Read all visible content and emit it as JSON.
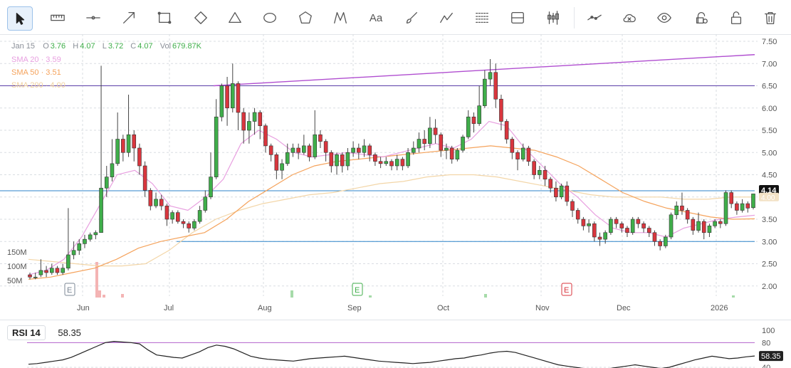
{
  "toolbar": {
    "tools": [
      {
        "name": "cursor-tool",
        "icon": "cursor-icon",
        "active": true
      },
      {
        "name": "measure-tool",
        "icon": "ruler-icon"
      },
      {
        "name": "horizontal-line-tool",
        "icon": "horizontal-line-icon"
      },
      {
        "name": "trend-line-tool",
        "icon": "arrow-line-icon"
      },
      {
        "name": "rectangle-tool",
        "icon": "rectangle-icon"
      },
      {
        "name": "rotated-rectangle-tool",
        "icon": "diamond-icon"
      },
      {
        "name": "triangle-tool",
        "icon": "triangle-icon"
      },
      {
        "name": "ellipse-tool",
        "icon": "ellipse-icon"
      },
      {
        "name": "polygon-tool",
        "icon": "polygon-icon"
      },
      {
        "name": "xabcd-pattern-tool",
        "icon": "pattern-icon"
      },
      {
        "name": "text-tool",
        "icon": "text-icon",
        "label": "Aa"
      },
      {
        "name": "brush-tool",
        "icon": "brush-icon"
      },
      {
        "name": "path-tool",
        "icon": "path-icon"
      },
      {
        "name": "fib-retracement-tool",
        "icon": "fib-icon"
      },
      {
        "name": "long-short-position-tool",
        "icon": "position-icon"
      },
      {
        "name": "magnet-tool",
        "icon": "candles-icon"
      },
      {
        "name": "show-drawings-tool",
        "icon": "line-visibility-icon"
      },
      {
        "name": "delete-drawings-x-tool",
        "icon": "cloud-x-icon"
      },
      {
        "name": "hide-drawings-tool",
        "icon": "eye-icon"
      },
      {
        "name": "lock-drawings-tool",
        "icon": "lock-settings-icon"
      },
      {
        "name": "unlock-tool",
        "icon": "unlock-icon"
      },
      {
        "name": "delete-tool",
        "icon": "trash-icon"
      }
    ]
  },
  "legend": {
    "date": "Jan 15",
    "open_key": "O",
    "open": "3.76",
    "high_key": "H",
    "high": "4.07",
    "low_key": "L",
    "low": "3.72",
    "close_key": "C",
    "close": "4.07",
    "vol_key": "Vol",
    "volume": "679.87K",
    "sma20": "SMA 20 · 3.59",
    "sma50": "SMA 50 · 3.51",
    "sma200": "SMA 200 · 4.00"
  },
  "colors": {
    "up": "#3fae4a",
    "down": "#d9363e",
    "sma20": "#e8a0e0",
    "sma50": "#f5a35c",
    "sma200": "#f3d6a8",
    "hline": "#2c83c9",
    "trendline": "#b04ed0",
    "resistance": "#5b3fa8",
    "rsi": "#222222",
    "rsi_fill": "#c58ee6",
    "price_tag": "#111111"
  },
  "chart_data": {
    "type": "candlestick",
    "y_axis": {
      "ticks": [
        "7.50",
        "7.00",
        "6.50",
        "6.00",
        "5.50",
        "5.00",
        "4.50",
        "4.00",
        "3.50",
        "3.00",
        "2.50",
        "2.00"
      ],
      "ylim": [
        1.9,
        7.5
      ],
      "position": "right"
    },
    "volume_axis": {
      "ticks": [
        "150M",
        "100M",
        "50M"
      ]
    },
    "x_axis": {
      "labels": [
        "Jun",
        "Jul",
        "Aug",
        "Sep",
        "Oct",
        "Nov",
        "Dec",
        "2026"
      ]
    },
    "events": [
      "E",
      "E",
      "E"
    ],
    "candles": [
      [
        2.25,
        2.2,
        2.3,
        2.15
      ],
      [
        2.2,
        2.2,
        2.3,
        2.15
      ],
      [
        2.25,
        2.35,
        2.6,
        2.2
      ],
      [
        2.35,
        2.3,
        2.45,
        2.2
      ],
      [
        2.3,
        2.4,
        2.5,
        2.25
      ],
      [
        2.4,
        2.3,
        2.45,
        2.25
      ],
      [
        2.3,
        2.4,
        2.5,
        2.25
      ],
      [
        2.4,
        2.7,
        3.75,
        2.35
      ],
      [
        2.7,
        2.8,
        3.0,
        2.6
      ],
      [
        2.8,
        2.95,
        3.05,
        2.7
      ],
      [
        2.95,
        3.05,
        3.15,
        2.85
      ],
      [
        3.05,
        3.15,
        3.2,
        3.0
      ],
      [
        3.15,
        3.2,
        3.25,
        3.05
      ],
      [
        3.2,
        4.2,
        6.95,
        4.05
      ],
      [
        4.2,
        4.45,
        4.7,
        4.0
      ],
      [
        4.45,
        4.75,
        5.3,
        4.35
      ],
      [
        4.75,
        5.3,
        5.9,
        4.7
      ],
      [
        5.3,
        5.0,
        5.4,
        4.8
      ],
      [
        5.0,
        5.4,
        6.3,
        4.9
      ],
      [
        5.4,
        5.1,
        5.5,
        4.8
      ],
      [
        5.1,
        4.7,
        5.2,
        4.5
      ],
      [
        4.7,
        4.15,
        4.8,
        4.0
      ],
      [
        4.15,
        3.8,
        4.2,
        3.7
      ],
      [
        3.8,
        3.95,
        4.1,
        3.75
      ],
      [
        3.95,
        3.8,
        4.05,
        3.7
      ],
      [
        3.8,
        3.5,
        3.85,
        3.35
      ],
      [
        3.5,
        3.65,
        3.7,
        3.4
      ],
      [
        3.65,
        3.45,
        3.7,
        3.4
      ],
      [
        3.45,
        3.4,
        3.5,
        3.3
      ],
      [
        3.4,
        3.3,
        3.45,
        3.2
      ],
      [
        3.3,
        3.45,
        3.5,
        3.25
      ],
      [
        3.45,
        3.7,
        3.8,
        3.4
      ],
      [
        3.7,
        4.0,
        4.15,
        3.65
      ],
      [
        4.0,
        4.45,
        5.0,
        3.95
      ],
      [
        4.45,
        5.8,
        6.2,
        4.4
      ],
      [
        5.8,
        6.5,
        6.55,
        5.7
      ],
      [
        6.5,
        6.0,
        6.7,
        5.6
      ],
      [
        6.0,
        6.55,
        7.0,
        5.9
      ],
      [
        6.55,
        5.9,
        6.6,
        5.5
      ],
      [
        5.9,
        5.5,
        6.0,
        5.2
      ],
      [
        5.5,
        5.7,
        5.9,
        5.2
      ],
      [
        5.7,
        5.9,
        6.0,
        5.4
      ],
      [
        5.9,
        5.6,
        5.95,
        5.3
      ],
      [
        5.6,
        5.15,
        5.65,
        5.0
      ],
      [
        5.15,
        4.95,
        5.2,
        4.8
      ],
      [
        4.95,
        4.6,
        5.0,
        4.4
      ],
      [
        4.6,
        4.75,
        4.85,
        4.4
      ],
      [
        4.75,
        5.0,
        5.2,
        4.7
      ],
      [
        5.0,
        5.1,
        5.2,
        4.9
      ],
      [
        5.1,
        5.0,
        5.2,
        4.85
      ],
      [
        5.0,
        5.15,
        5.4,
        4.95
      ],
      [
        5.15,
        4.9,
        5.2,
        4.8
      ],
      [
        4.9,
        5.4,
        5.95,
        4.85
      ],
      [
        5.4,
        5.25,
        5.5,
        5.1
      ],
      [
        5.25,
        5.0,
        5.3,
        4.8
      ],
      [
        5.0,
        4.7,
        5.05,
        4.55
      ],
      [
        4.7,
        4.95,
        5.0,
        4.5
      ],
      [
        4.95,
        4.7,
        5.0,
        4.55
      ],
      [
        4.7,
        5.0,
        5.1,
        4.6
      ],
      [
        5.0,
        5.1,
        5.25,
        4.9
      ],
      [
        5.1,
        5.0,
        5.2,
        4.85
      ],
      [
        5.0,
        5.15,
        5.3,
        4.9
      ],
      [
        5.15,
        4.95,
        5.2,
        4.8
      ],
      [
        4.95,
        4.8,
        5.0,
        4.7
      ],
      [
        4.8,
        4.75,
        4.9,
        4.65
      ],
      [
        4.75,
        4.8,
        4.9,
        4.7
      ],
      [
        4.8,
        4.7,
        4.85,
        4.6
      ],
      [
        4.7,
        4.85,
        4.95,
        4.6
      ],
      [
        4.85,
        4.7,
        4.9,
        4.6
      ],
      [
        4.7,
        5.0,
        5.1,
        4.65
      ],
      [
        5.0,
        5.1,
        5.25,
        4.95
      ],
      [
        5.1,
        5.3,
        5.45,
        5.0
      ],
      [
        5.3,
        5.2,
        5.5,
        5.05
      ],
      [
        5.2,
        5.55,
        5.8,
        5.1
      ],
      [
        5.55,
        5.4,
        5.75,
        5.2
      ],
      [
        5.4,
        5.05,
        5.45,
        4.9
      ],
      [
        5.05,
        5.1,
        5.2,
        4.85
      ],
      [
        5.1,
        4.85,
        5.15,
        4.75
      ],
      [
        4.85,
        5.05,
        5.1,
        4.8
      ],
      [
        5.05,
        5.35,
        5.4,
        5.0
      ],
      [
        5.35,
        5.8,
        5.95,
        5.3
      ],
      [
        5.8,
        5.65,
        5.9,
        5.45
      ],
      [
        5.65,
        6.05,
        6.5,
        5.6
      ],
      [
        6.05,
        6.65,
        6.85,
        6.0
      ],
      [
        6.65,
        6.8,
        7.1,
        6.5
      ],
      [
        6.8,
        6.2,
        7.0,
        6.0
      ],
      [
        6.2,
        5.7,
        6.3,
        5.5
      ],
      [
        5.7,
        5.3,
        5.75,
        5.2
      ],
      [
        5.3,
        5.0,
        5.35,
        4.85
      ],
      [
        5.0,
        4.85,
        5.05,
        4.6
      ],
      [
        4.85,
        5.1,
        5.2,
        4.8
      ],
      [
        5.1,
        4.8,
        5.15,
        4.7
      ],
      [
        4.8,
        4.5,
        4.85,
        4.4
      ],
      [
        4.5,
        4.6,
        4.7,
        4.4
      ],
      [
        4.6,
        4.4,
        4.7,
        4.25
      ],
      [
        4.4,
        4.2,
        4.45,
        4.1
      ],
      [
        4.2,
        4.0,
        4.35,
        3.9
      ],
      [
        4.0,
        4.25,
        4.3,
        3.95
      ],
      [
        4.25,
        3.9,
        4.35,
        3.8
      ],
      [
        3.9,
        3.7,
        3.95,
        3.55
      ],
      [
        3.7,
        3.5,
        3.75,
        3.4
      ],
      [
        3.5,
        3.35,
        3.55,
        3.25
      ],
      [
        3.35,
        3.4,
        3.5,
        3.2
      ],
      [
        3.4,
        3.1,
        3.45,
        3.0
      ],
      [
        3.1,
        3.05,
        3.2,
        2.9
      ],
      [
        3.05,
        3.2,
        3.25,
        2.95
      ],
      [
        3.2,
        3.5,
        3.55,
        3.15
      ],
      [
        3.5,
        3.4,
        3.55,
        3.3
      ],
      [
        3.4,
        3.3,
        3.45,
        3.2
      ],
      [
        3.3,
        3.2,
        3.35,
        3.1
      ],
      [
        3.2,
        3.5,
        3.55,
        3.15
      ],
      [
        3.5,
        3.4,
        3.55,
        3.3
      ],
      [
        3.4,
        3.3,
        3.45,
        3.2
      ],
      [
        3.3,
        3.2,
        3.35,
        3.1
      ],
      [
        3.2,
        3.0,
        3.25,
        2.9
      ],
      [
        3.0,
        2.9,
        3.05,
        2.8
      ],
      [
        2.9,
        3.1,
        3.15,
        2.85
      ],
      [
        3.1,
        3.6,
        3.65,
        3.05
      ],
      [
        3.6,
        3.8,
        3.9,
        3.5
      ],
      [
        3.8,
        3.7,
        4.1,
        3.6
      ],
      [
        3.7,
        3.5,
        3.75,
        3.4
      ],
      [
        3.5,
        3.25,
        3.55,
        3.15
      ],
      [
        3.25,
        3.45,
        3.65,
        3.2
      ],
      [
        3.45,
        3.2,
        3.5,
        3.05
      ],
      [
        3.2,
        3.35,
        3.4,
        3.1
      ],
      [
        3.35,
        3.45,
        3.5,
        3.3
      ],
      [
        3.45,
        3.4,
        3.5,
        3.3
      ],
      [
        3.4,
        4.1,
        4.15,
        3.35
      ],
      [
        4.1,
        3.85,
        4.15,
        3.75
      ],
      [
        3.85,
        3.7,
        3.9,
        3.6
      ],
      [
        3.7,
        3.85,
        3.95,
        3.65
      ],
      [
        3.85,
        3.75,
        3.9,
        3.65
      ],
      [
        3.76,
        4.07,
        4.07,
        3.72
      ]
    ],
    "sma20": [
      2.25,
      2.35,
      2.6,
      3.1,
      3.8,
      4.5,
      4.6,
      4.3,
      3.8,
      3.7,
      4.0,
      4.4,
      5.2,
      5.5,
      5.3,
      5.0,
      4.9,
      4.95,
      5.0,
      4.95,
      4.9,
      5.0,
      5.1,
      5.2,
      5.1,
      5.3,
      5.7,
      5.6,
      5.1,
      4.7,
      4.3,
      4.0,
      3.6,
      3.3,
      3.2,
      3.2,
      3.1,
      3.3,
      3.4,
      3.5,
      3.55,
      3.59
    ],
    "sma50": [
      2.15,
      2.2,
      2.3,
      2.4,
      2.6,
      2.85,
      3.0,
      3.1,
      3.2,
      3.5,
      3.9,
      4.2,
      4.5,
      4.7,
      4.8,
      4.85,
      4.9,
      4.95,
      5.0,
      5.05,
      5.1,
      5.15,
      5.1,
      5.05,
      4.9,
      4.7,
      4.4,
      4.1,
      3.9,
      3.75,
      3.65,
      3.55,
      3.5,
      3.51
    ],
    "sma200": [
      2.6,
      2.55,
      2.5,
      2.45,
      2.45,
      2.5,
      2.8,
      3.2,
      3.5,
      3.7,
      3.85,
      3.95,
      4.05,
      4.1,
      4.2,
      4.3,
      4.35,
      4.45,
      4.5,
      4.5,
      4.45,
      4.35,
      4.25,
      4.15,
      4.05,
      4.0,
      4.0,
      4.0,
      3.95,
      3.95,
      4.0,
      4.0
    ],
    "hlines": [
      6.5,
      4.14,
      3.0
    ],
    "trendline": {
      "from": 6.5,
      "to": 7.2
    },
    "current_price": "4.14",
    "sma200_tag": "4.00"
  },
  "rsi": {
    "label": "RSI 14",
    "value": "58.35",
    "ticks": [
      "100",
      "80",
      "40"
    ],
    "series": [
      45,
      46,
      48,
      50,
      52,
      56,
      62,
      68,
      74,
      80,
      82,
      81,
      80,
      78,
      68,
      60,
      58,
      56,
      55,
      60,
      65,
      72,
      76,
      74,
      70,
      64,
      58,
      55,
      53,
      52,
      51,
      50,
      52,
      54,
      55,
      56,
      57,
      58,
      56,
      54,
      52,
      50,
      49,
      48,
      47,
      46,
      47,
      48,
      50,
      52,
      54,
      55,
      58,
      60,
      63,
      65,
      66,
      64,
      60,
      56,
      52,
      48,
      44,
      42,
      40,
      38,
      37,
      36,
      38,
      40,
      42,
      44,
      42,
      40,
      38,
      40,
      44,
      48,
      52,
      55,
      58,
      56,
      54,
      55,
      57,
      58.35
    ]
  }
}
